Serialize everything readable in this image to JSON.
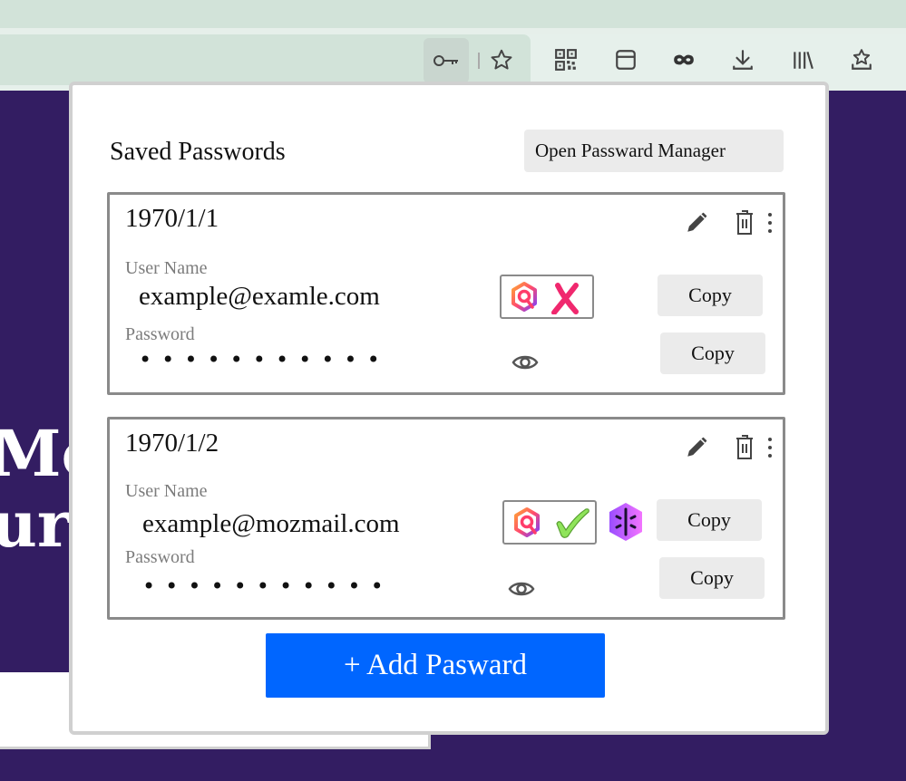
{
  "browser": {
    "toolbar_icons": [
      "key-icon",
      "bookmark-star-icon",
      "qr-code-icon",
      "sidebar-icon",
      "private-mask-icon",
      "download-icon",
      "library-icon",
      "extension-star-icon"
    ]
  },
  "page": {
    "title_fragment_line1": "Mo",
    "title_fragment_line2": "ur"
  },
  "popup": {
    "title": "Saved Passwords",
    "open_manager_label": "Open Passward Manager",
    "entries": [
      {
        "date": "1970/1/1",
        "username_label": "User Name",
        "username": "example@examle.com",
        "password_label": "Password",
        "password_mask": "•••••••••••",
        "copy_username_label": "Copy",
        "copy_password_label": "Copy",
        "breach_status": "unsafe",
        "has_relay_mask": false
      },
      {
        "date": "1970/1/2",
        "username_label": "User Name",
        "username": "example@mozmail.com",
        "password_label": "Password",
        "password_mask": "•••••••••••",
        "copy_username_label": "Copy",
        "copy_password_label": "Copy",
        "breach_status": "safe",
        "has_relay_mask": true
      }
    ],
    "add_button_label": "+ Add Pasward"
  },
  "colors": {
    "accent": "#0066ff",
    "page_background": "#331d62",
    "toolbar": "#e6f0eb",
    "unsafe_mark": "#f0286e",
    "safe_mark": "#8fe45a"
  }
}
